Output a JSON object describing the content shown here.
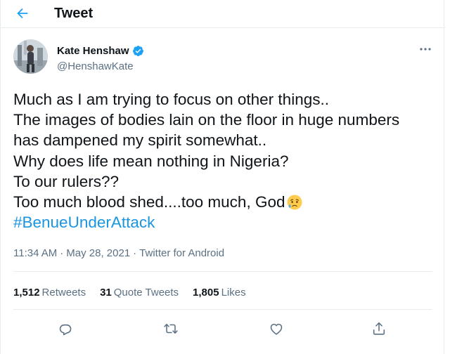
{
  "header": {
    "back_icon": "back-arrow-icon",
    "title": "Tweet"
  },
  "author": {
    "name": "Kate Henshaw",
    "handle": "@HenshawKate",
    "verified": true
  },
  "tweet": {
    "lines": [
      "Much as I am trying to focus on other things..",
      "The images of bodies lain on the floor in huge numbers",
      "has dampened my spirit somewhat..",
      "Why does life mean nothing in Nigeria?",
      "To our rulers??",
      "Too much blood shed....too much, God"
    ],
    "emoji": "crying-face-emoji",
    "hashtag": "#BenueUnderAttack"
  },
  "meta": {
    "time": "11:34 AM",
    "sep1": "·",
    "date": "May 28, 2021",
    "sep2": "·",
    "app": "Twitter for Android"
  },
  "stats": {
    "retweets_count": "1,512",
    "retweets_label": "Retweets",
    "quotes_count": "31",
    "quotes_label": "Quote Tweets",
    "likes_count": "1,805",
    "likes_label": "Likes"
  },
  "colors": {
    "accent": "#1da1f2",
    "hashtag": "#1b95e0",
    "secondary_text": "#5b7083",
    "divider": "#e6ecf0"
  },
  "actions": [
    "reply-icon",
    "retweet-icon",
    "like-icon",
    "share-icon"
  ]
}
